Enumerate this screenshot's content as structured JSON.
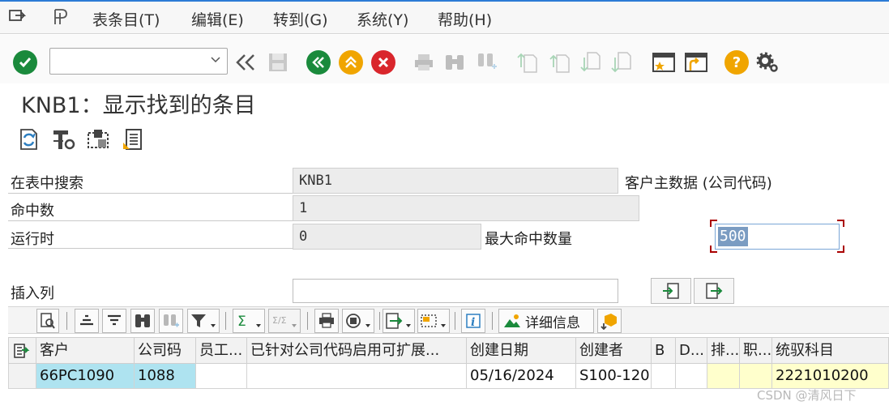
{
  "menubar": {
    "items": [
      "表条目(T)",
      "编辑(E)",
      "转到(G)",
      "系统(Y)",
      "帮助(H)"
    ]
  },
  "toolbar": {
    "command_value": "",
    "icons": [
      "enter-icon",
      "back-double-icon",
      "save-icon",
      "back-icon",
      "exit-icon",
      "cancel-icon",
      "print-icon",
      "find-icon",
      "find-next-icon",
      "first-page-icon",
      "prev-page-icon",
      "next-page-icon",
      "last-page-icon",
      "new-session-icon",
      "shortcut-icon",
      "help-icon",
      "settings-icon"
    ],
    "colors": {
      "green": "#1a8a3c",
      "orange": "#f0a500",
      "red": "#d9262c"
    }
  },
  "page": {
    "title": "KNB1：显示找到的条目"
  },
  "form": {
    "search_in_table_label": "在表中搜索",
    "table_value": "KNB1",
    "table_desc": "客户主数据 (公司代码)",
    "hits_label": "命中数",
    "hits_value": "1",
    "runtime_label": "运行时",
    "runtime_value": "0",
    "max_hits_label": "最大命中数量",
    "max_hits_value": "500",
    "insert_col_label": "插入列"
  },
  "alv": {
    "details_label": "详细信息"
  },
  "grid": {
    "columns": [
      "客户",
      "公司码",
      "员工...",
      "已针对公司代码启用可扩展...",
      "创建日期",
      "创建者",
      "B",
      "D...",
      "排...",
      "职...",
      "统驭科目"
    ],
    "rows": [
      [
        "66PC1090",
        "1088",
        "",
        "",
        "05/16/2024",
        "S100-120",
        "",
        "",
        "",
        "",
        "2221010200"
      ]
    ]
  },
  "watermark": "CSDN @清风日下"
}
